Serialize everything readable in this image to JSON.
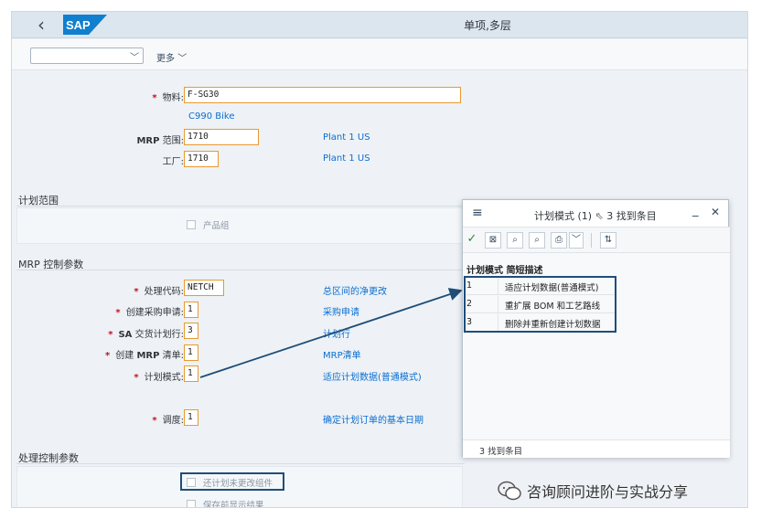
{
  "shell": {
    "title": "单项,多层",
    "logo_text": "SAP"
  },
  "toolbar": {
    "more_label": "更多",
    "variant_value": ""
  },
  "header_fields": {
    "material": {
      "label": "物料:",
      "value": "F-SG30",
      "desc": "C990 Bike"
    },
    "mrp_area": {
      "label_a": "MRP",
      "label_b": " 范围:",
      "value": "1710",
      "desc": "Plant 1 US"
    },
    "plant": {
      "label": "工厂:",
      "value": "1710",
      "desc": "Plant 1 US"
    }
  },
  "section_scope": {
    "title": "计划范围",
    "checkbox_label": "产品组"
  },
  "section_mrp": {
    "title": "MRP 控制参数",
    "fields": [
      {
        "label": "处理代码:",
        "value": "NETCH",
        "desc": "总区间的净更改"
      },
      {
        "label": "创建采购申请:",
        "value": "1",
        "desc": "采购申请"
      },
      {
        "label_a": "SA",
        "label_b": " 交货计划行:",
        "value": "3",
        "desc": "计划行"
      },
      {
        "label_a": "创建 ",
        "label_b": "MRP",
        "label_c": " 清单:",
        "value": "1",
        "desc": "MRP清单"
      },
      {
        "label": "计划模式:",
        "value": "1",
        "desc": "适应计划数据(普通模式)"
      },
      {
        "label": "调度:",
        "value": "1",
        "desc": "确定计划订单的基本日期"
      }
    ]
  },
  "section_proc": {
    "title": "处理控制参数",
    "checkboxes": [
      "还计划未更改组件",
      "保存前显示结果"
    ]
  },
  "popup": {
    "title": "计划模式 (1)",
    "found": "3 找到条目",
    "header": "计划模式 简短描述",
    "rows": [
      {
        "key": "1",
        "text": "适应计划数据(普通模式)"
      },
      {
        "key": "2",
        "text": "重扩展 BOM 和工艺路线"
      },
      {
        "key": "3",
        "text": "删除并重新创建计划数据"
      }
    ],
    "footer": "3 找到条目"
  },
  "watermark": {
    "text": "咨询顾问进阶与实战分享"
  },
  "colors": {
    "shell_bg": "#dce6ef",
    "link": "#0a6ed1",
    "required": "#c1121f",
    "input_border": "#e89a2c",
    "highlight": "#1f4e79",
    "logo": "#0f7fce"
  }
}
